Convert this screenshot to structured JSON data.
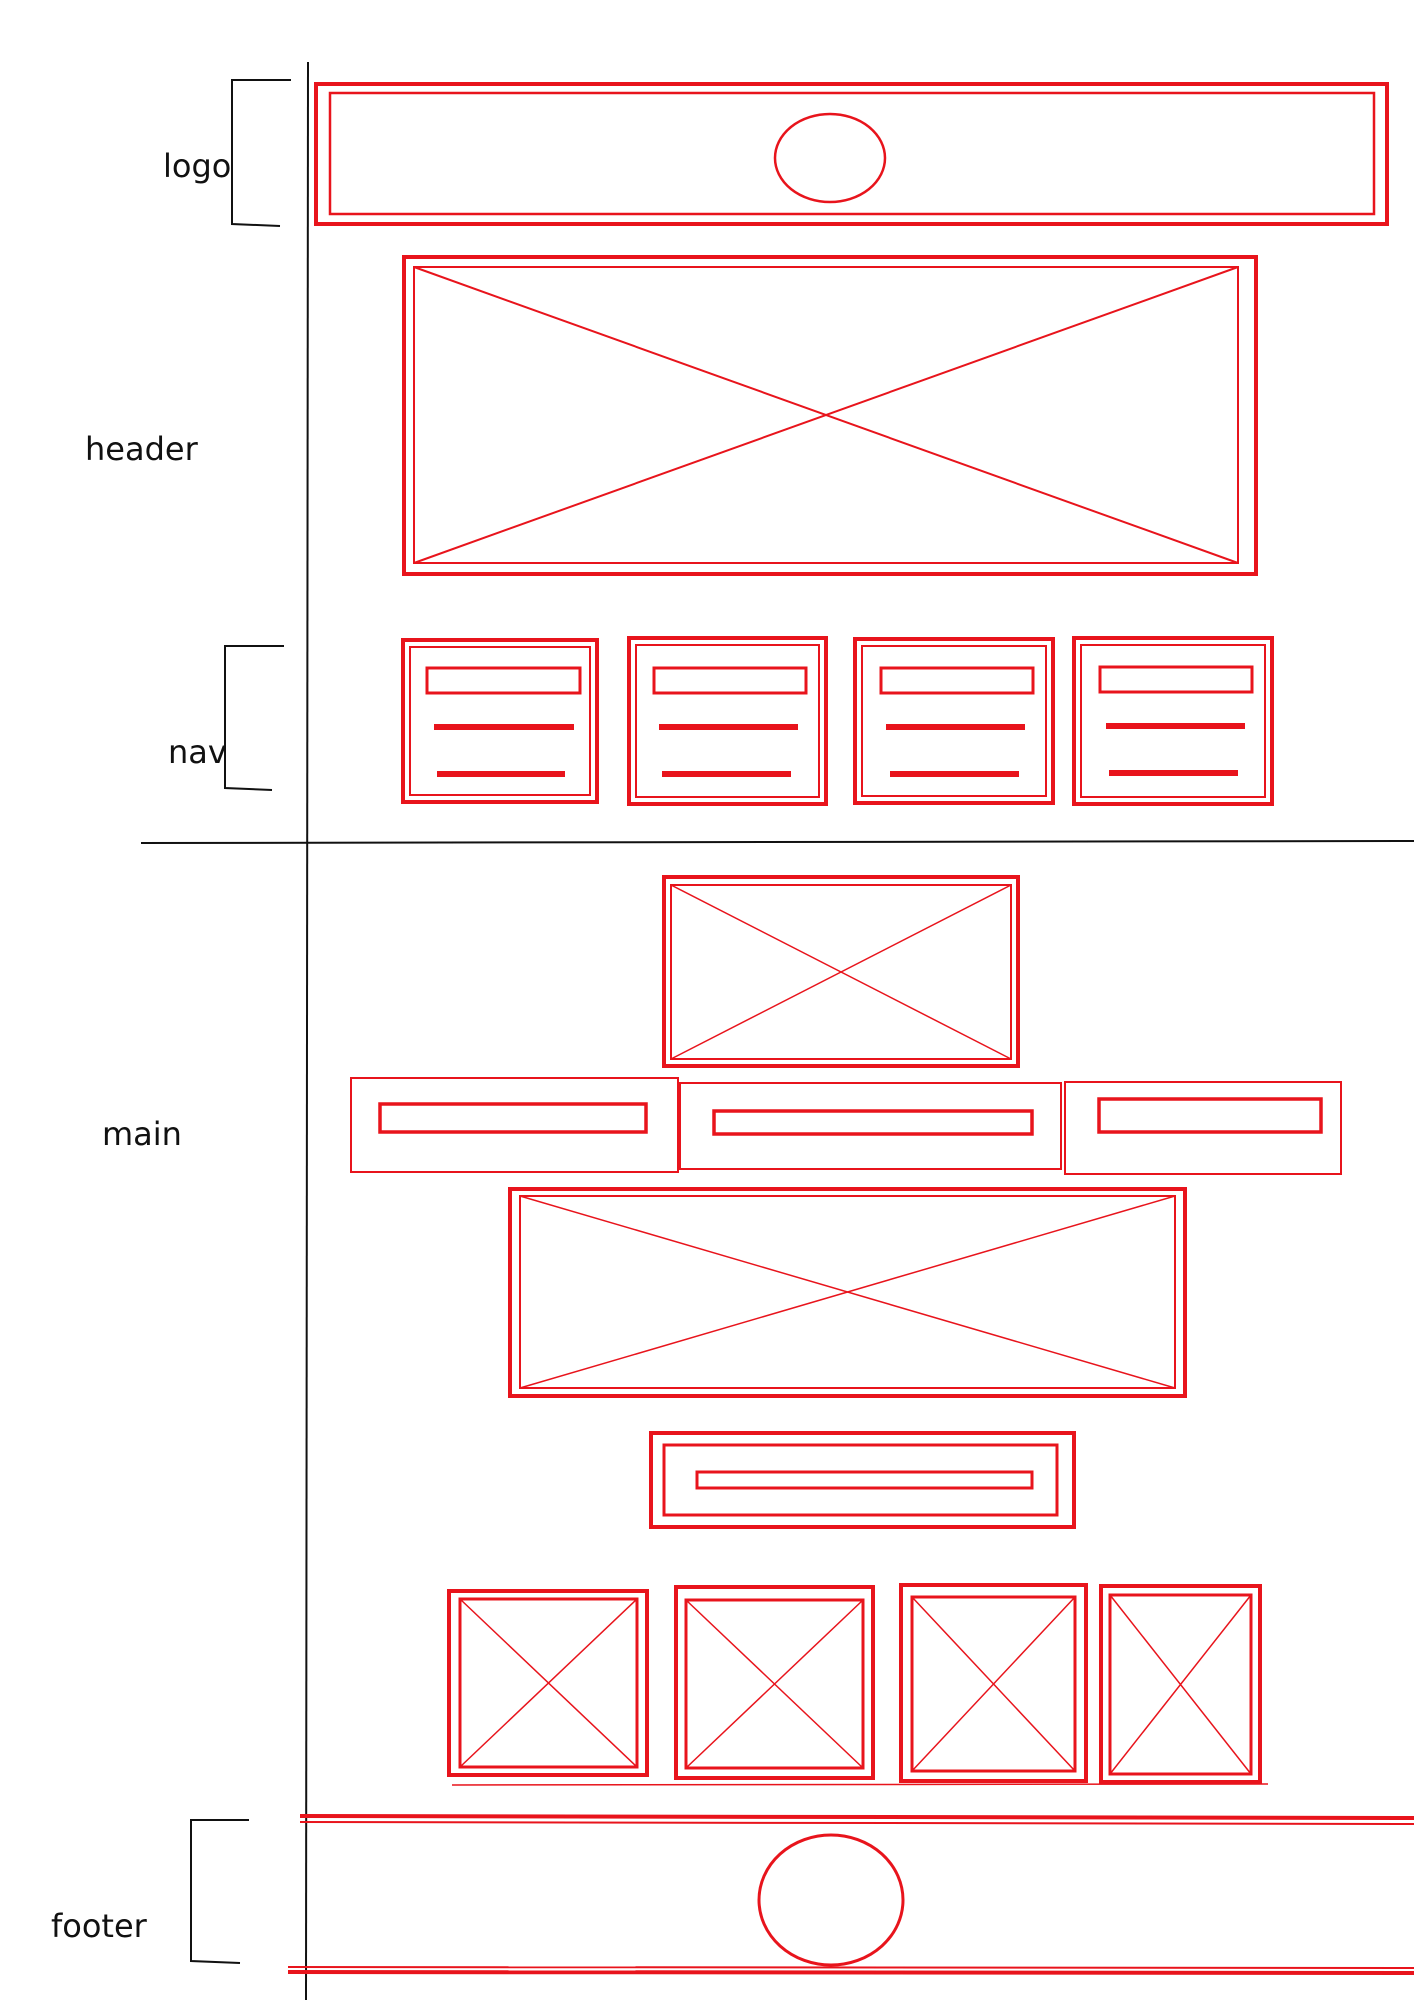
{
  "colors": {
    "ink": "#111111",
    "wire": "#e8141c"
  },
  "labels": {
    "logo": "logo",
    "header": "header",
    "nav": "nav",
    "main": "main",
    "footer": "footer"
  }
}
